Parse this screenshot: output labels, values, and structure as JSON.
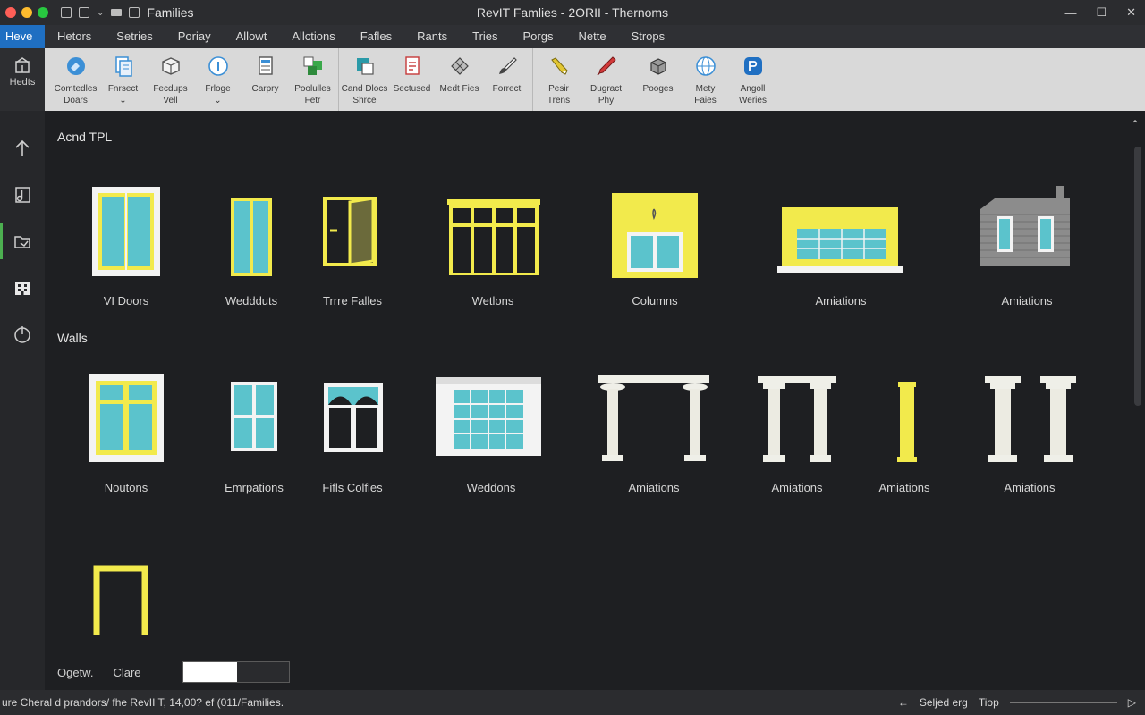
{
  "titlebar": {
    "app_name": "Families",
    "window_title": "RevIT Famlies - 2ORII - Thernoms",
    "traffic_colors": [
      "#ff5f57",
      "#febc2e",
      "#28c840"
    ],
    "controls": [
      "—",
      "☐",
      "✕"
    ]
  },
  "menu": {
    "tabs": [
      "Heve",
      "Hetors",
      "Setries",
      "Poriay",
      "Allowt",
      "Allctions",
      "Fafles",
      "Rants",
      "Tries",
      "Porgs",
      "Nette",
      "Strops"
    ]
  },
  "ribbon": {
    "buttons": [
      {
        "label": "Comtedles\nDoars",
        "icon": "globe-wrench-icon",
        "color": "#3b8fd6"
      },
      {
        "label": "Fnrsect\n⌄",
        "icon": "document-stack-icon",
        "color": "#3b8fd6"
      },
      {
        "label": "Fecdups\nVell",
        "icon": "box-icon",
        "color": "#6b6b6b"
      },
      {
        "label": "Frloge\n⌄",
        "icon": "info-circle-icon",
        "color": "#3b8fd6"
      },
      {
        "label": "Carpry",
        "icon": "form-icon",
        "color": "#3b8fd6"
      },
      {
        "label": "Poolulles\nFetr",
        "icon": "green-squares-icon",
        "color": "#3aa84a"
      },
      {
        "label": "Cand Dlocs\nShrce",
        "icon": "teal-box-icon",
        "color": "#2a9aa8"
      },
      {
        "label": "Sectused",
        "icon": "red-document-icon",
        "color": "#c63a3a"
      },
      {
        "label": "Medt Fies",
        "icon": "grid-tile-icon",
        "color": "#6b6b6b"
      },
      {
        "label": "Forrect",
        "icon": "brush-icon",
        "color": "#6b6b6b"
      },
      {
        "label": "Pesir\nTrens",
        "icon": "yellow-pencil-icon",
        "color": "#e2c632"
      },
      {
        "label": "Dugract\nPhy",
        "icon": "red-pen-icon",
        "color": "#d23a3a"
      },
      {
        "label": "Pooges",
        "icon": "cube-stack-icon",
        "color": "#6b6b6b"
      },
      {
        "label": "Mety\nFaies",
        "icon": "globe-icon",
        "color": "#3b8fd6"
      },
      {
        "label": "Angoll\nWeries",
        "icon": "blue-badge-icon",
        "color": "#1f6fc2"
      }
    ]
  },
  "leftrail": {
    "home_label": "Hedts",
    "items": [
      "up-arrow-icon",
      "music-doc-icon",
      "folder-icon",
      "building-icon",
      "power-icon"
    ]
  },
  "sections": [
    {
      "title": "Acnd TPL",
      "items": [
        {
          "label": "VI Doors",
          "icon": "double-door-icon"
        },
        {
          "label": "Weddduts",
          "icon": "narrow-door-icon"
        },
        {
          "label": "Trrre Falles",
          "icon": "open-door-icon"
        },
        {
          "label": "Wetlons",
          "icon": "storefront-window-icon"
        },
        {
          "label": "Columns",
          "icon": "yellow-wall-window-icon"
        },
        {
          "label": "Amiations",
          "icon": "banded-window-icon"
        },
        {
          "label": "Amiations",
          "icon": "brick-house-icon"
        }
      ]
    },
    {
      "title": "Walls",
      "items": [
        {
          "label": "Noutons",
          "icon": "four-pane-window-icon"
        },
        {
          "label": "Emrpations",
          "icon": "teal-window-icon"
        },
        {
          "label": "Fifls Colfles",
          "icon": "arched-window-icon"
        },
        {
          "label": "Weddons",
          "icon": "wide-window-icon"
        },
        {
          "label": "Amiations",
          "icon": "colonnade-icon"
        },
        {
          "label": "Amiations",
          "icon": "portal-columns-icon"
        },
        {
          "label": "Amiations",
          "icon": "yellow-column-icon"
        },
        {
          "label": "Amiations",
          "icon": "twin-columns-icon"
        }
      ]
    }
  ],
  "extra_item": {
    "icon": "yellow-frame-icon"
  },
  "bottom": {
    "label1": "Ogetw.",
    "label2": "Clare"
  },
  "status": {
    "text": "ure Cheral d prandors/ fhe RevII T, 14,00? ef (011/Families.",
    "right_label1": "Seljed erg",
    "right_label2": "Tiop"
  },
  "colors": {
    "teal": "#5bc3cc",
    "yellow": "#f2ea4c",
    "frame_white": "#f3f3f3",
    "accent_blue": "#1f6fc2"
  }
}
